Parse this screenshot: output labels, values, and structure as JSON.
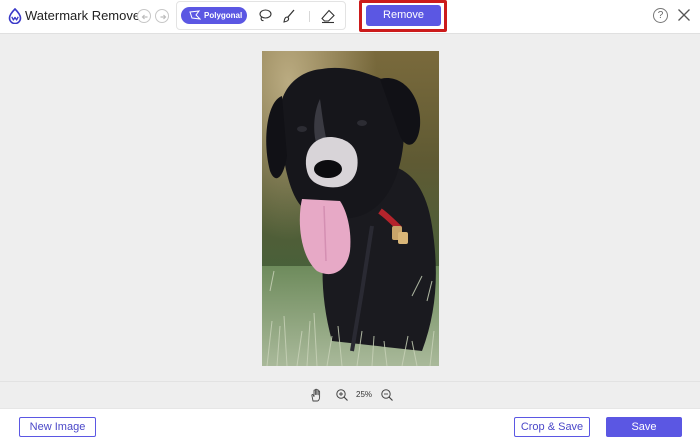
{
  "app": {
    "title": "Watermark Remover",
    "accent_color": "#5b57e3",
    "highlight_color": "#cc1b1b"
  },
  "toolbar": {
    "undo_icon": "undo-icon",
    "redo_icon": "redo-icon",
    "tools": [
      {
        "id": "polygonal",
        "label": "Polygonal",
        "icon": "polygon-lasso-icon",
        "active": true
      },
      {
        "id": "lasso",
        "icon": "lasso-icon",
        "active": false
      },
      {
        "id": "brush",
        "icon": "brush-icon",
        "active": false
      },
      {
        "id": "eraser",
        "icon": "eraser-icon",
        "active": false
      }
    ],
    "remove_label": "Remove",
    "help_label": "?",
    "close_icon": "close-icon"
  },
  "canvas": {
    "image": "dog-photo"
  },
  "zoom": {
    "hand_icon": "hand-icon",
    "zoom_in_icon": "zoom-in-icon",
    "level": "25%",
    "zoom_out_icon": "zoom-out-icon"
  },
  "footer": {
    "new_image_label": "New Image",
    "crop_save_label": "Crop & Save",
    "save_label": "Save"
  }
}
